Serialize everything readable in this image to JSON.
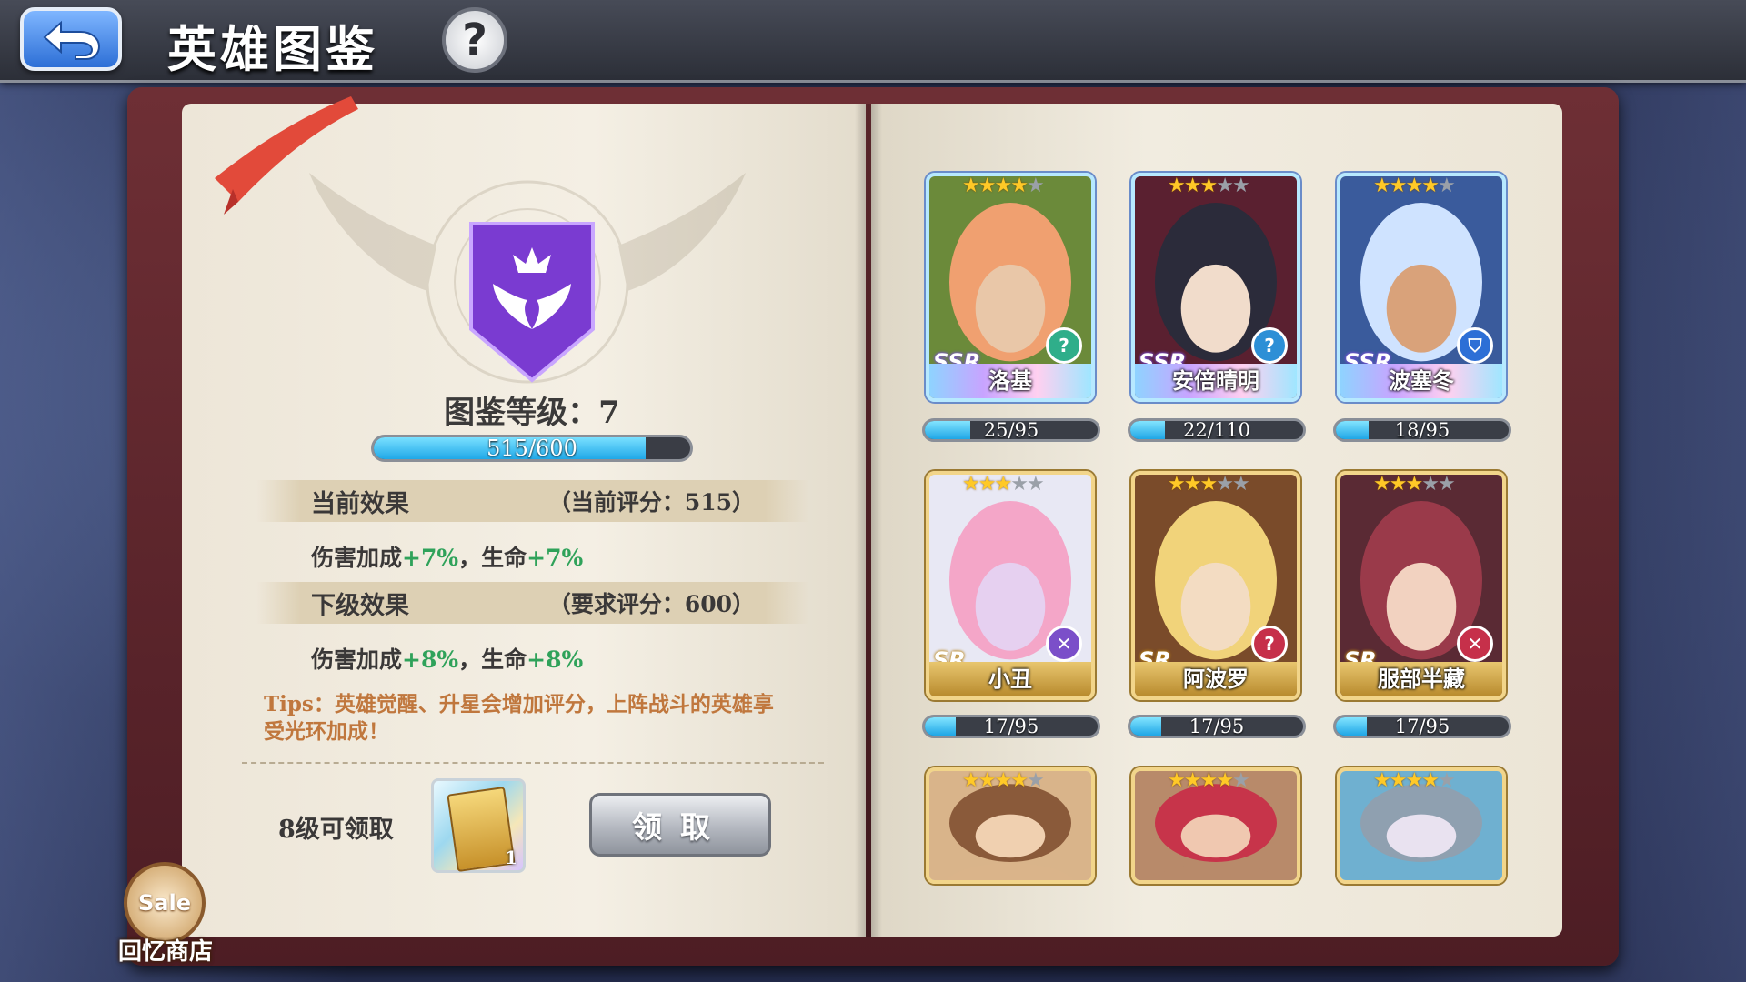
{
  "header": {
    "title": "英雄图鉴",
    "help_glyph": "?"
  },
  "collection": {
    "level_label": "图鉴等级：7",
    "progress": {
      "current": 515,
      "max": 600,
      "text": "515/600"
    },
    "current_effect": {
      "title": "当前效果",
      "score_text": "（当前评分：515）",
      "text_a": "伤害加成",
      "value_a": "+7%",
      "sep": "，",
      "text_b": "生命",
      "value_b": "+7%"
    },
    "next_effect": {
      "title": "下级效果",
      "score_text": "（要求评分：600）",
      "text_a": "伤害加成",
      "value_a": "+8%",
      "sep": "，",
      "text_b": "生命",
      "value_b": "+8%"
    },
    "tips": "Tips：英雄觉醒、升星会增加评分，上阵战斗的英雄享受光环加成！",
    "reward": {
      "label": "8级可领取",
      "quantity": "1",
      "claim_label": "领取"
    }
  },
  "shop": {
    "badge": "Sale",
    "label": "回忆商店"
  },
  "heroes": [
    {
      "name": "洛基",
      "rarity": "SSR",
      "stars": 4,
      "progress": "25/95",
      "fraction": 0.263,
      "class_glyph": "?",
      "class_color": "#2fae8a"
    },
    {
      "name": "安倍晴明",
      "rarity": "SSR",
      "stars": 3,
      "progress": "22/110",
      "fraction": 0.2,
      "class_glyph": "?",
      "class_color": "#2d8fd6"
    },
    {
      "name": "波塞冬",
      "rarity": "SSR",
      "stars": 4,
      "progress": "18/95",
      "fraction": 0.189,
      "class_glyph": "⛉",
      "class_color": "#2d6fd6"
    },
    {
      "name": "小丑",
      "rarity": "SR",
      "stars": 3,
      "progress": "17/95",
      "fraction": 0.179,
      "class_glyph": "✕",
      "class_color": "#7b4fc9"
    },
    {
      "name": "阿波罗",
      "rarity": "SR",
      "stars": 3,
      "progress": "17/95",
      "fraction": 0.179,
      "class_glyph": "?",
      "class_color": "#c6304a"
    },
    {
      "name": "服部半藏",
      "rarity": "SR",
      "stars": 3,
      "progress": "17/95",
      "fraction": 0.179,
      "class_glyph": "✕",
      "class_color": "#c6304a"
    },
    {
      "name": "",
      "rarity": "",
      "stars": 4,
      "progress": "",
      "fraction": 0
    },
    {
      "name": "",
      "rarity": "",
      "stars": 4,
      "progress": "",
      "fraction": 0
    },
    {
      "name": "",
      "rarity": "",
      "stars": 4,
      "progress": "",
      "fraction": 0
    }
  ],
  "colors": {
    "accent": "#1fa8e8",
    "bonus_green": "#2fa25a",
    "tips_orange": "#c0773d"
  }
}
